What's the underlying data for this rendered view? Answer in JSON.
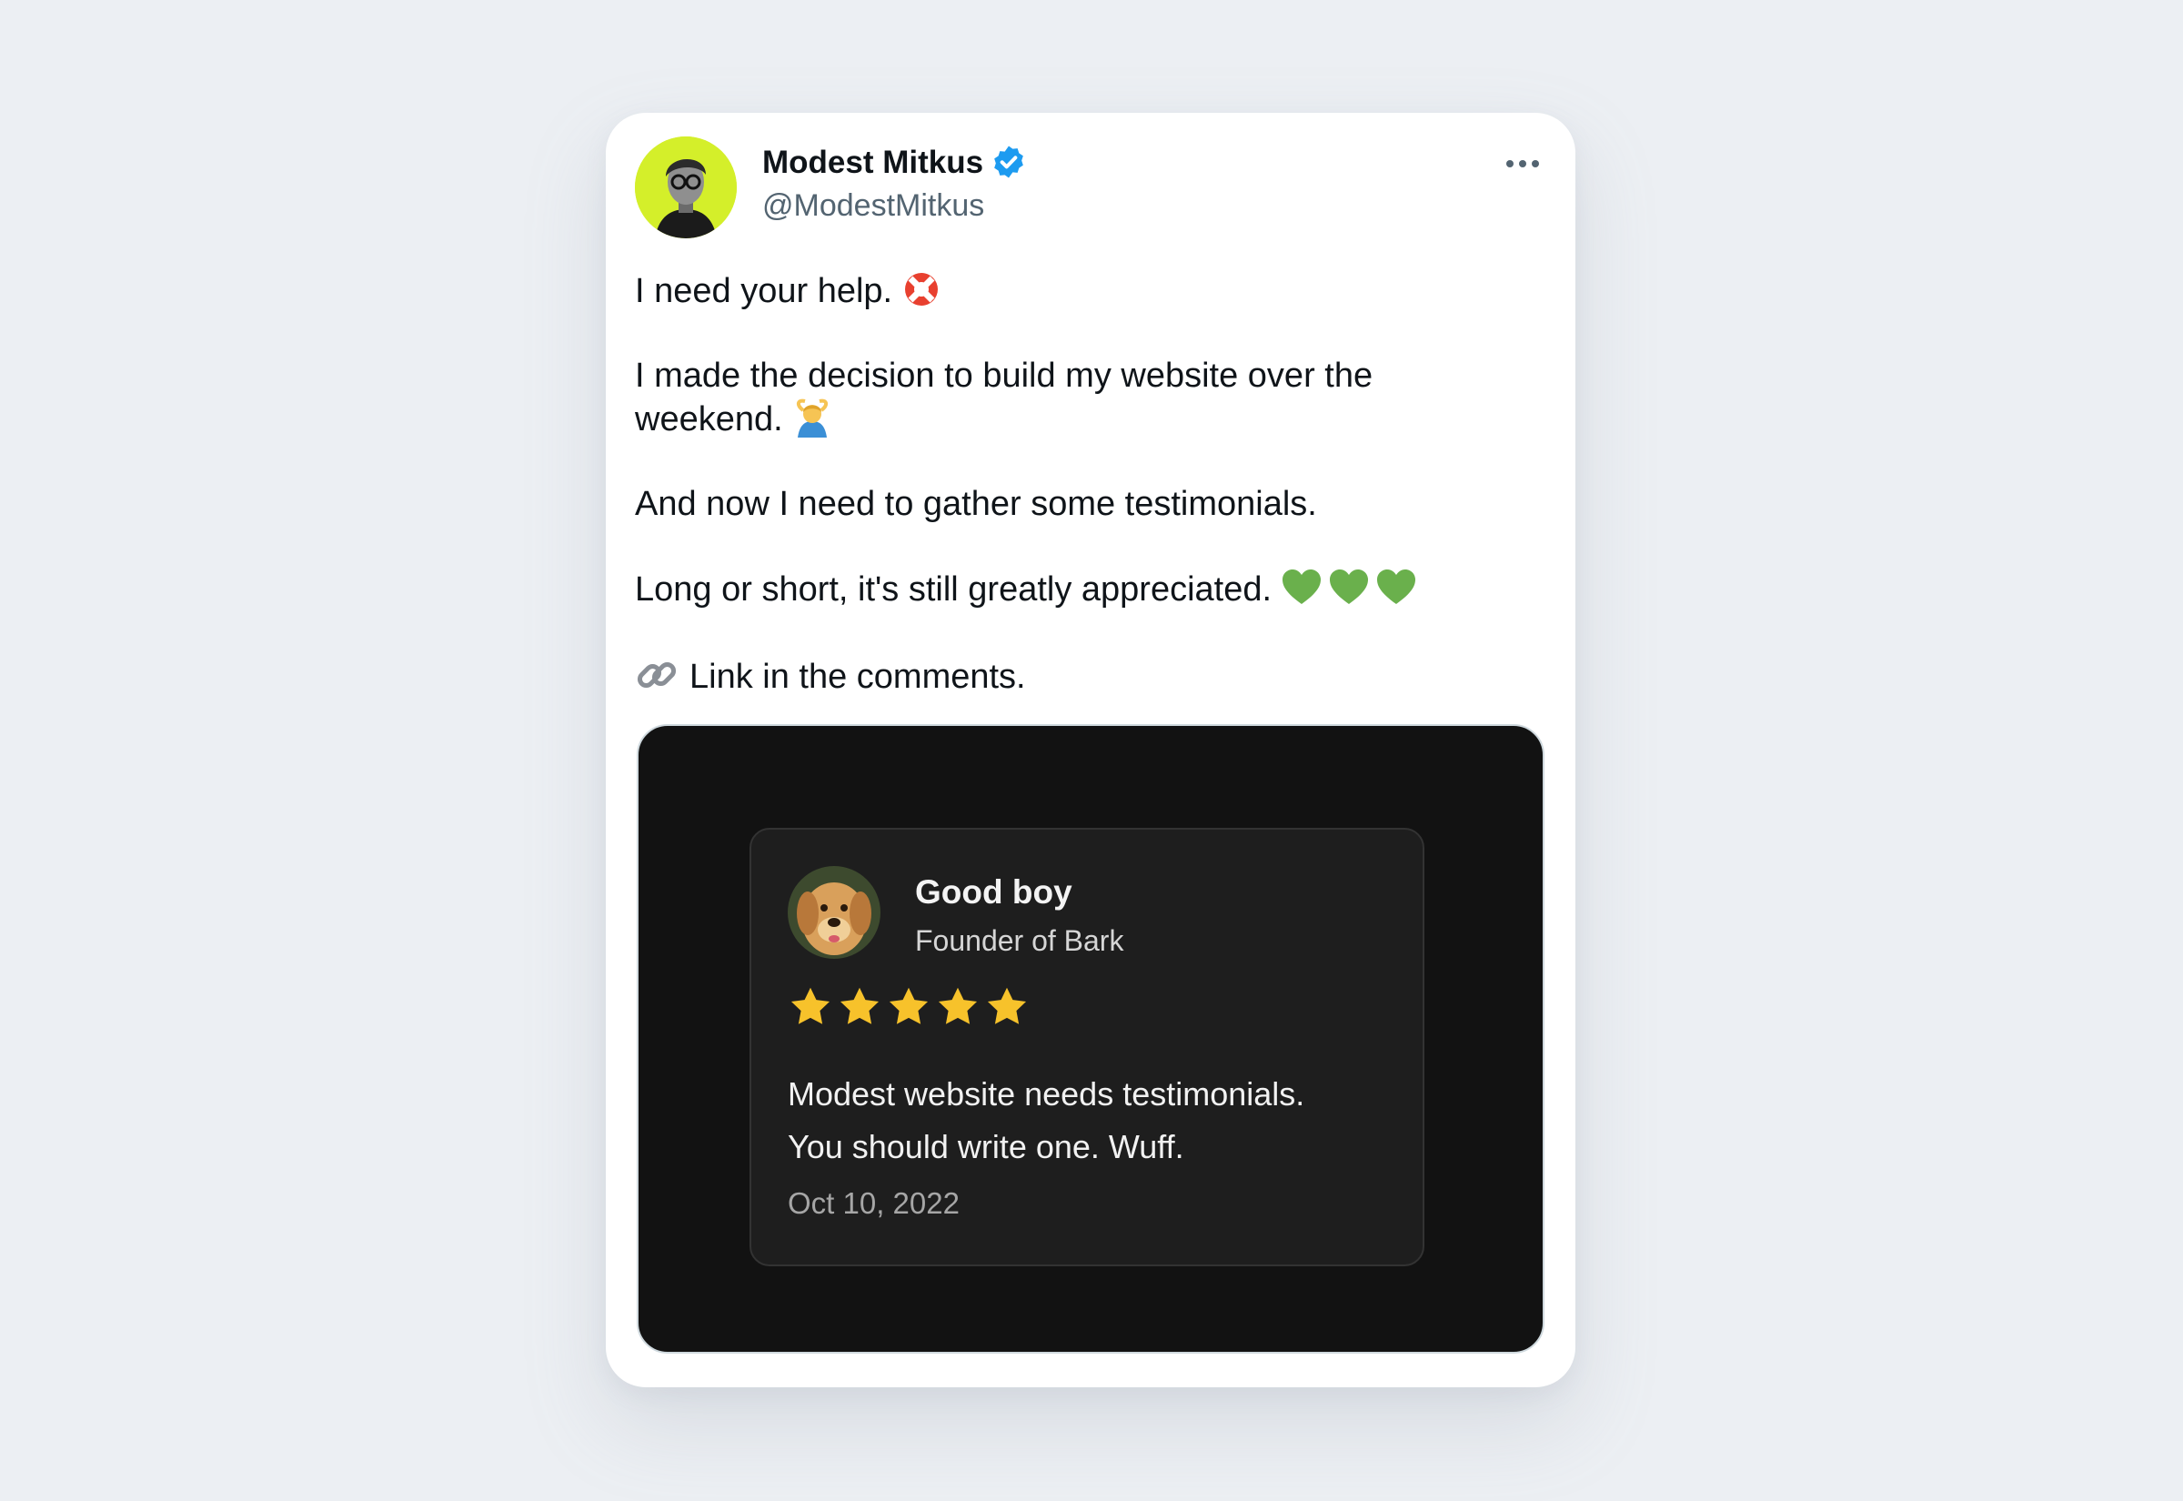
{
  "tweet": {
    "author": {
      "name": "Modest Mitkus",
      "handle": "@ModestMitkus",
      "verified": true,
      "avatar_bg": "#d4ef2a"
    },
    "more_icon": "more-horizontal-icon",
    "lines": {
      "l1": "I need your help.",
      "l2": "I made the decision to build my website over the\nweekend.",
      "l3": "And now I need to gather some testimonials.",
      "l4": "Long or short, it's still greatly appreciated.",
      "l5": "Link in the comments."
    },
    "emojis": [
      "lifebuoy-icon",
      "person-gesturing-ok-icon",
      "green-heart-icon",
      "link-icon"
    ]
  },
  "testimonial": {
    "name": "Good boy",
    "title": "Founder of Bark",
    "rating": 5,
    "text_line1": "Modest website needs testimonials.",
    "text_line2": "You should write one. Wuff.",
    "date": "Oct 10, 2022",
    "star_color": "#f7c22b"
  },
  "colors": {
    "page_bg": "#eceff3",
    "card_bg": "#ffffff",
    "verified_blue": "#1d9bf0",
    "media_bg": "#121212",
    "heart_green": "#6ab04c"
  }
}
